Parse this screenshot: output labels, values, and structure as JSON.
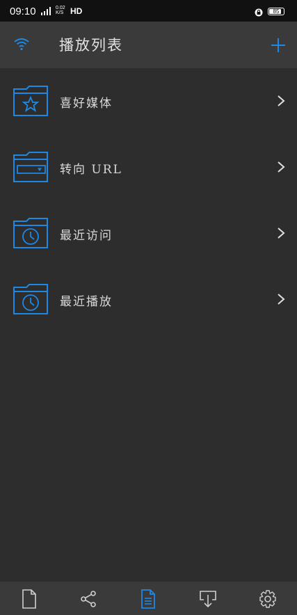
{
  "status_bar": {
    "time": "09:10",
    "network_speed_value": "0.02",
    "network_speed_unit": "K/S",
    "hd_label": "HD",
    "battery_level": "85"
  },
  "header": {
    "title": "播放列表",
    "wifi_icon": "wifi-icon",
    "add_icon": "plus-icon"
  },
  "playlist": {
    "items": [
      {
        "label": "喜好媒体",
        "icon": "folder-star-icon"
      },
      {
        "label": "转向 URL",
        "icon": "folder-url-icon"
      },
      {
        "label": "最近访问",
        "icon": "folder-clock-icon"
      },
      {
        "label": "最近播放",
        "icon": "folder-clock-icon"
      }
    ]
  },
  "bottom_nav": {
    "tabs": [
      {
        "icon": "file-icon",
        "active": false
      },
      {
        "icon": "share-icon",
        "active": false
      },
      {
        "icon": "playlist-document-icon",
        "active": true
      },
      {
        "icon": "download-icon",
        "active": false
      },
      {
        "icon": "settings-gear-icon",
        "active": false
      }
    ]
  },
  "colors": {
    "accent": "#1e88e5",
    "background": "#2d2d2d",
    "header_background": "#3a3a3a",
    "status_bar": "#111111"
  }
}
